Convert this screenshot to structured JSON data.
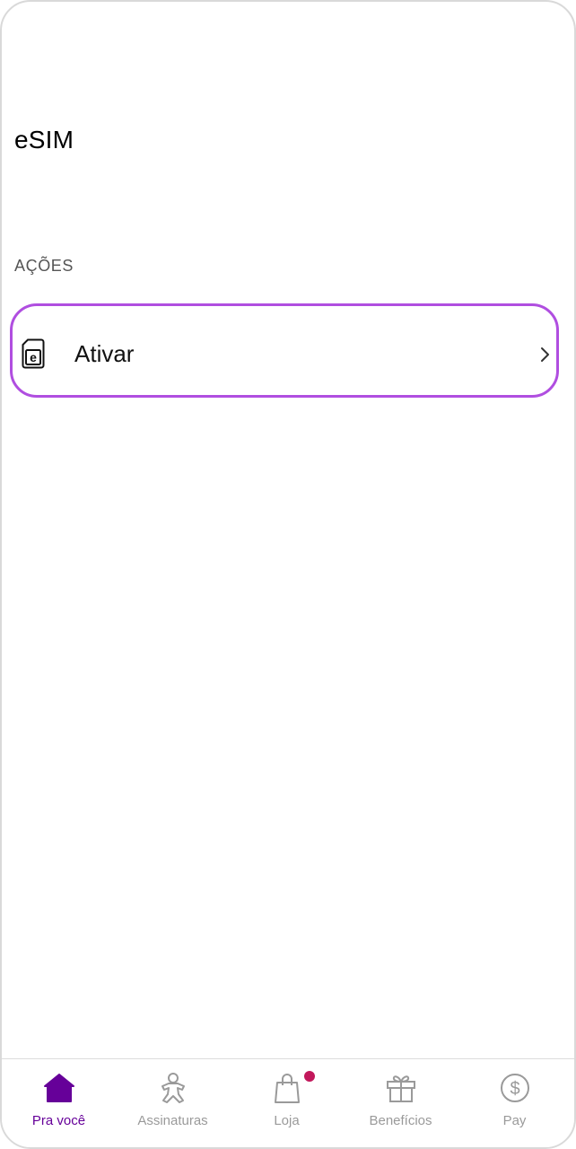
{
  "page": {
    "title": "eSIM",
    "section_label": "AÇÕES"
  },
  "actions": [
    {
      "label": "Ativar",
      "icon": "esim-card-icon"
    }
  ],
  "tab_bar": {
    "items": [
      {
        "label": "Pra você",
        "icon": "home-icon",
        "active": true
      },
      {
        "label": "Assinaturas",
        "icon": "gingerbread-figure-icon",
        "active": false
      },
      {
        "label": "Loja",
        "icon": "shopping-bag-icon",
        "active": false,
        "badge": true
      },
      {
        "label": "Benefícios",
        "icon": "gift-icon",
        "active": false
      },
      {
        "label": "Pay",
        "icon": "dollar-coin-icon",
        "active": false
      }
    ]
  },
  "colors": {
    "accent": "#660099",
    "highlight_border": "#b04ee0",
    "badge": "#c2185b",
    "inactive": "#9a9a9a"
  }
}
